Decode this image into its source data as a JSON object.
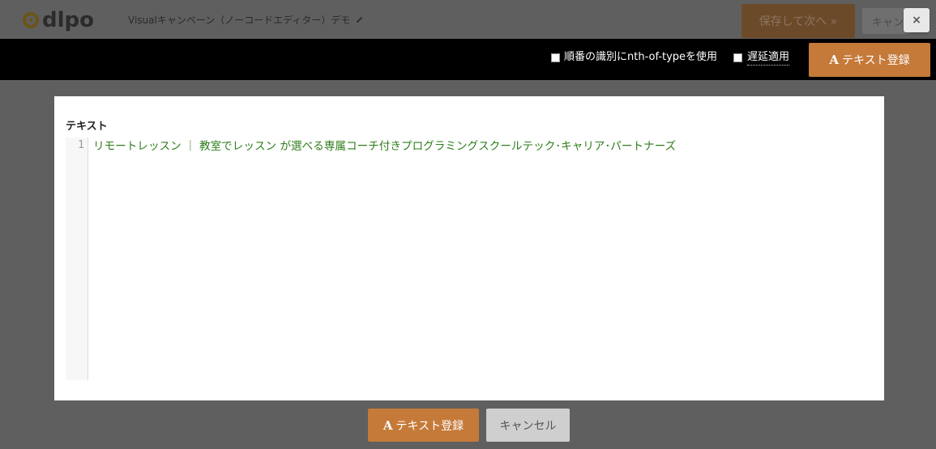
{
  "header": {
    "logo_text": "dlpo",
    "campaign_title": "Visualキャンペーン（ノーコードエディター）デモ",
    "save_next_label": "保存して次へ »",
    "cancel_label": "キャンセル"
  },
  "close_label": "×",
  "toolbar": {
    "nth_of_type_label": "順番の識別にnth-of-typeを使用",
    "lazy_apply_label": "遅延適用",
    "register_icon": "A",
    "register_label": "テキスト登録"
  },
  "editor": {
    "label": "テキスト",
    "line_number": "1",
    "content": "リモートレッスン ｜ 教室でレッスン が選べる専属コーチ付きプログラミングスクールテック･キャリア･パートナーズ"
  },
  "footer": {
    "register_icon": "A",
    "register_label": "テキスト登録",
    "cancel_label": "キャンセル"
  }
}
